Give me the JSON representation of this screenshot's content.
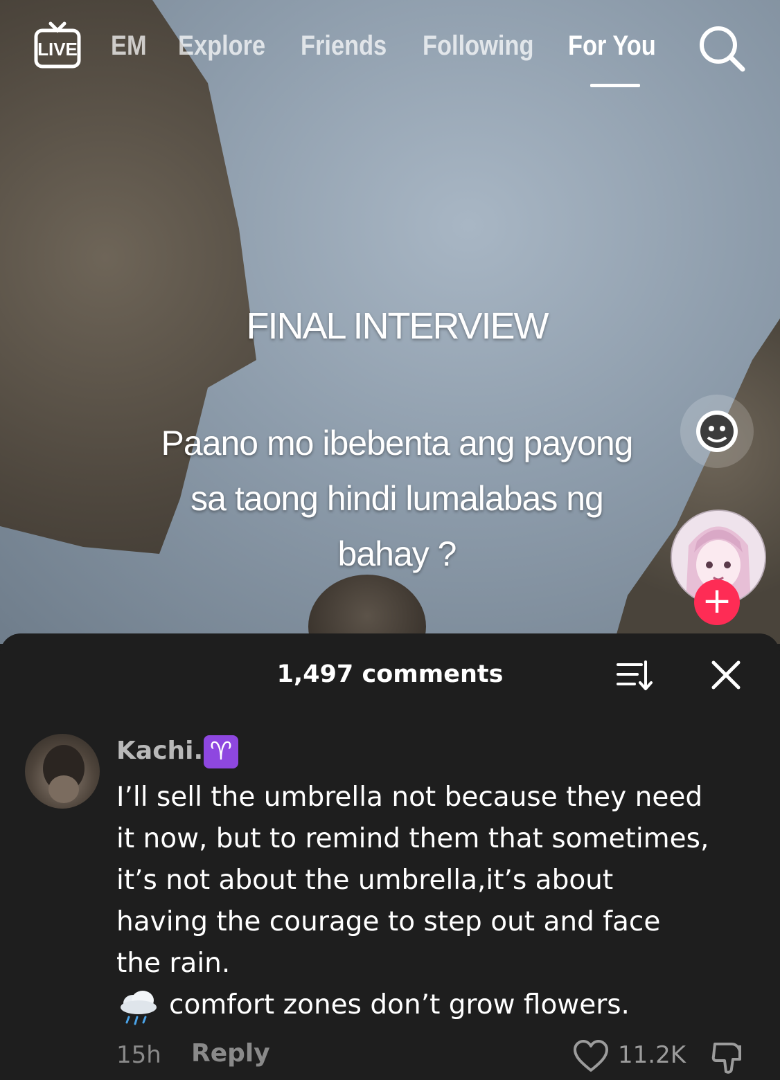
{
  "nav": {
    "live_label": "LIVE",
    "tabs": [
      {
        "label": "EM"
      },
      {
        "label": "Explore"
      },
      {
        "label": "Friends"
      },
      {
        "label": "Following"
      },
      {
        "label": "For You",
        "active": true
      }
    ]
  },
  "video": {
    "overlay_title": "FINAL INTERVIEW",
    "overlay_question": "Paano mo ibebenta ang payong\nsa taong hindi lumalabas ng\nbahay ?"
  },
  "comments_sheet": {
    "count_label": "1,497 comments",
    "comment": {
      "author": "Kachi.",
      "badge": "♈",
      "text": "I’ll sell the umbrella not because they need\nit now, but to remind them that sometimes,\nit’s not about the umbrella,it’s about\nhaving the courage to step out and face\nthe rain.",
      "tagline": "comfort zones don’t grow flowers.",
      "time": "15h",
      "reply_label": "Reply",
      "likes": "11.2K"
    }
  },
  "colors": {
    "follow_accent": "#fe2c55",
    "sheet_bg": "#1e1e1e",
    "badge_purple": "#8e47e0"
  },
  "icons": [
    "live-icon",
    "search-icon",
    "sticker-icon",
    "plus-icon",
    "sort-icon",
    "close-icon",
    "rain-cloud-icon",
    "heart-icon",
    "dislike-icon"
  ]
}
